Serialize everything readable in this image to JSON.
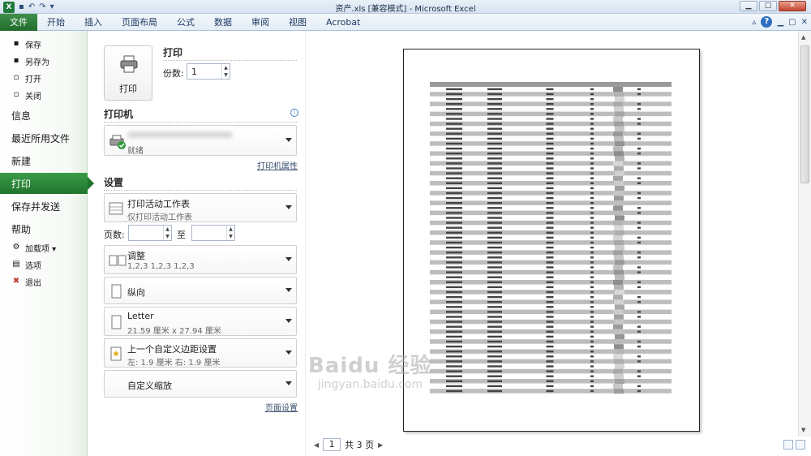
{
  "window": {
    "title": "资产.xls  [兼容模式]  -  Microsoft Excel",
    "min_label": "▁",
    "max_label": "▢",
    "close_label": "✕"
  },
  "ribbon": {
    "tabs": [
      "文件",
      "开始",
      "插入",
      "页面布局",
      "公式",
      "数据",
      "审阅",
      "视图",
      "Acrobat"
    ]
  },
  "nav": {
    "items": [
      {
        "label": "保存",
        "icon": "save-icon",
        "glyph": "▪",
        "size": "small"
      },
      {
        "label": "另存为",
        "icon": "save-as-icon",
        "glyph": "▪",
        "size": "small"
      },
      {
        "label": "打开",
        "icon": "folder-open-icon",
        "glyph": "▫",
        "size": "small"
      },
      {
        "label": "关闭",
        "icon": "close-file-icon",
        "glyph": "▫",
        "size": "small"
      },
      {
        "label": "信息",
        "size": "big"
      },
      {
        "label": "最近所用文件",
        "size": "big"
      },
      {
        "label": "新建",
        "size": "big"
      },
      {
        "label": "打印",
        "size": "big",
        "active": true
      },
      {
        "label": "保存并发送",
        "size": "big"
      },
      {
        "label": "帮助",
        "size": "big"
      },
      {
        "label": "加载项 ▾",
        "icon": "addin-icon",
        "glyph": "⚙",
        "size": "small"
      },
      {
        "label": "选项",
        "icon": "options-icon",
        "glyph": "▤",
        "size": "small"
      },
      {
        "label": "退出",
        "icon": "exit-icon",
        "glyph": "✖",
        "size": "small"
      }
    ]
  },
  "print": {
    "section_title": "打印",
    "button_label": "打印",
    "copies_label": "份数:",
    "copies_value": "1"
  },
  "printer": {
    "section_title": "机",
    "section_title_prefix": "打印",
    "status": "就绪",
    "properties_link": "打印机属性"
  },
  "settings": {
    "section_title": "设置",
    "what": {
      "title": "打印活动工作表",
      "subtitle": "仅打印活动工作表"
    },
    "pages_label": "页数:",
    "to_label": "至",
    "collate": {
      "title": "调整",
      "subtitle": "1,2,3    1,2,3    1,2,3"
    },
    "orientation": {
      "title": "纵向"
    },
    "paper": {
      "title": "Letter",
      "subtitle": "21.59 厘米 x 27.94 厘米"
    },
    "margins": {
      "title": "上一个自定义边距设置",
      "subtitle": "左:  1.9 厘米    右:  1.9 厘米"
    },
    "scaling": {
      "title": "自定义缩放"
    },
    "page_setup_link": "页面设置"
  },
  "preview": {
    "page_value": "1",
    "page_total": "共 3 页",
    "watermark": "Baidu 经验",
    "watermark_url": "jingyan.baidu.com"
  },
  "colors": {
    "accent_green": "#21742d",
    "ribbon_blue": "#1d3b63"
  }
}
